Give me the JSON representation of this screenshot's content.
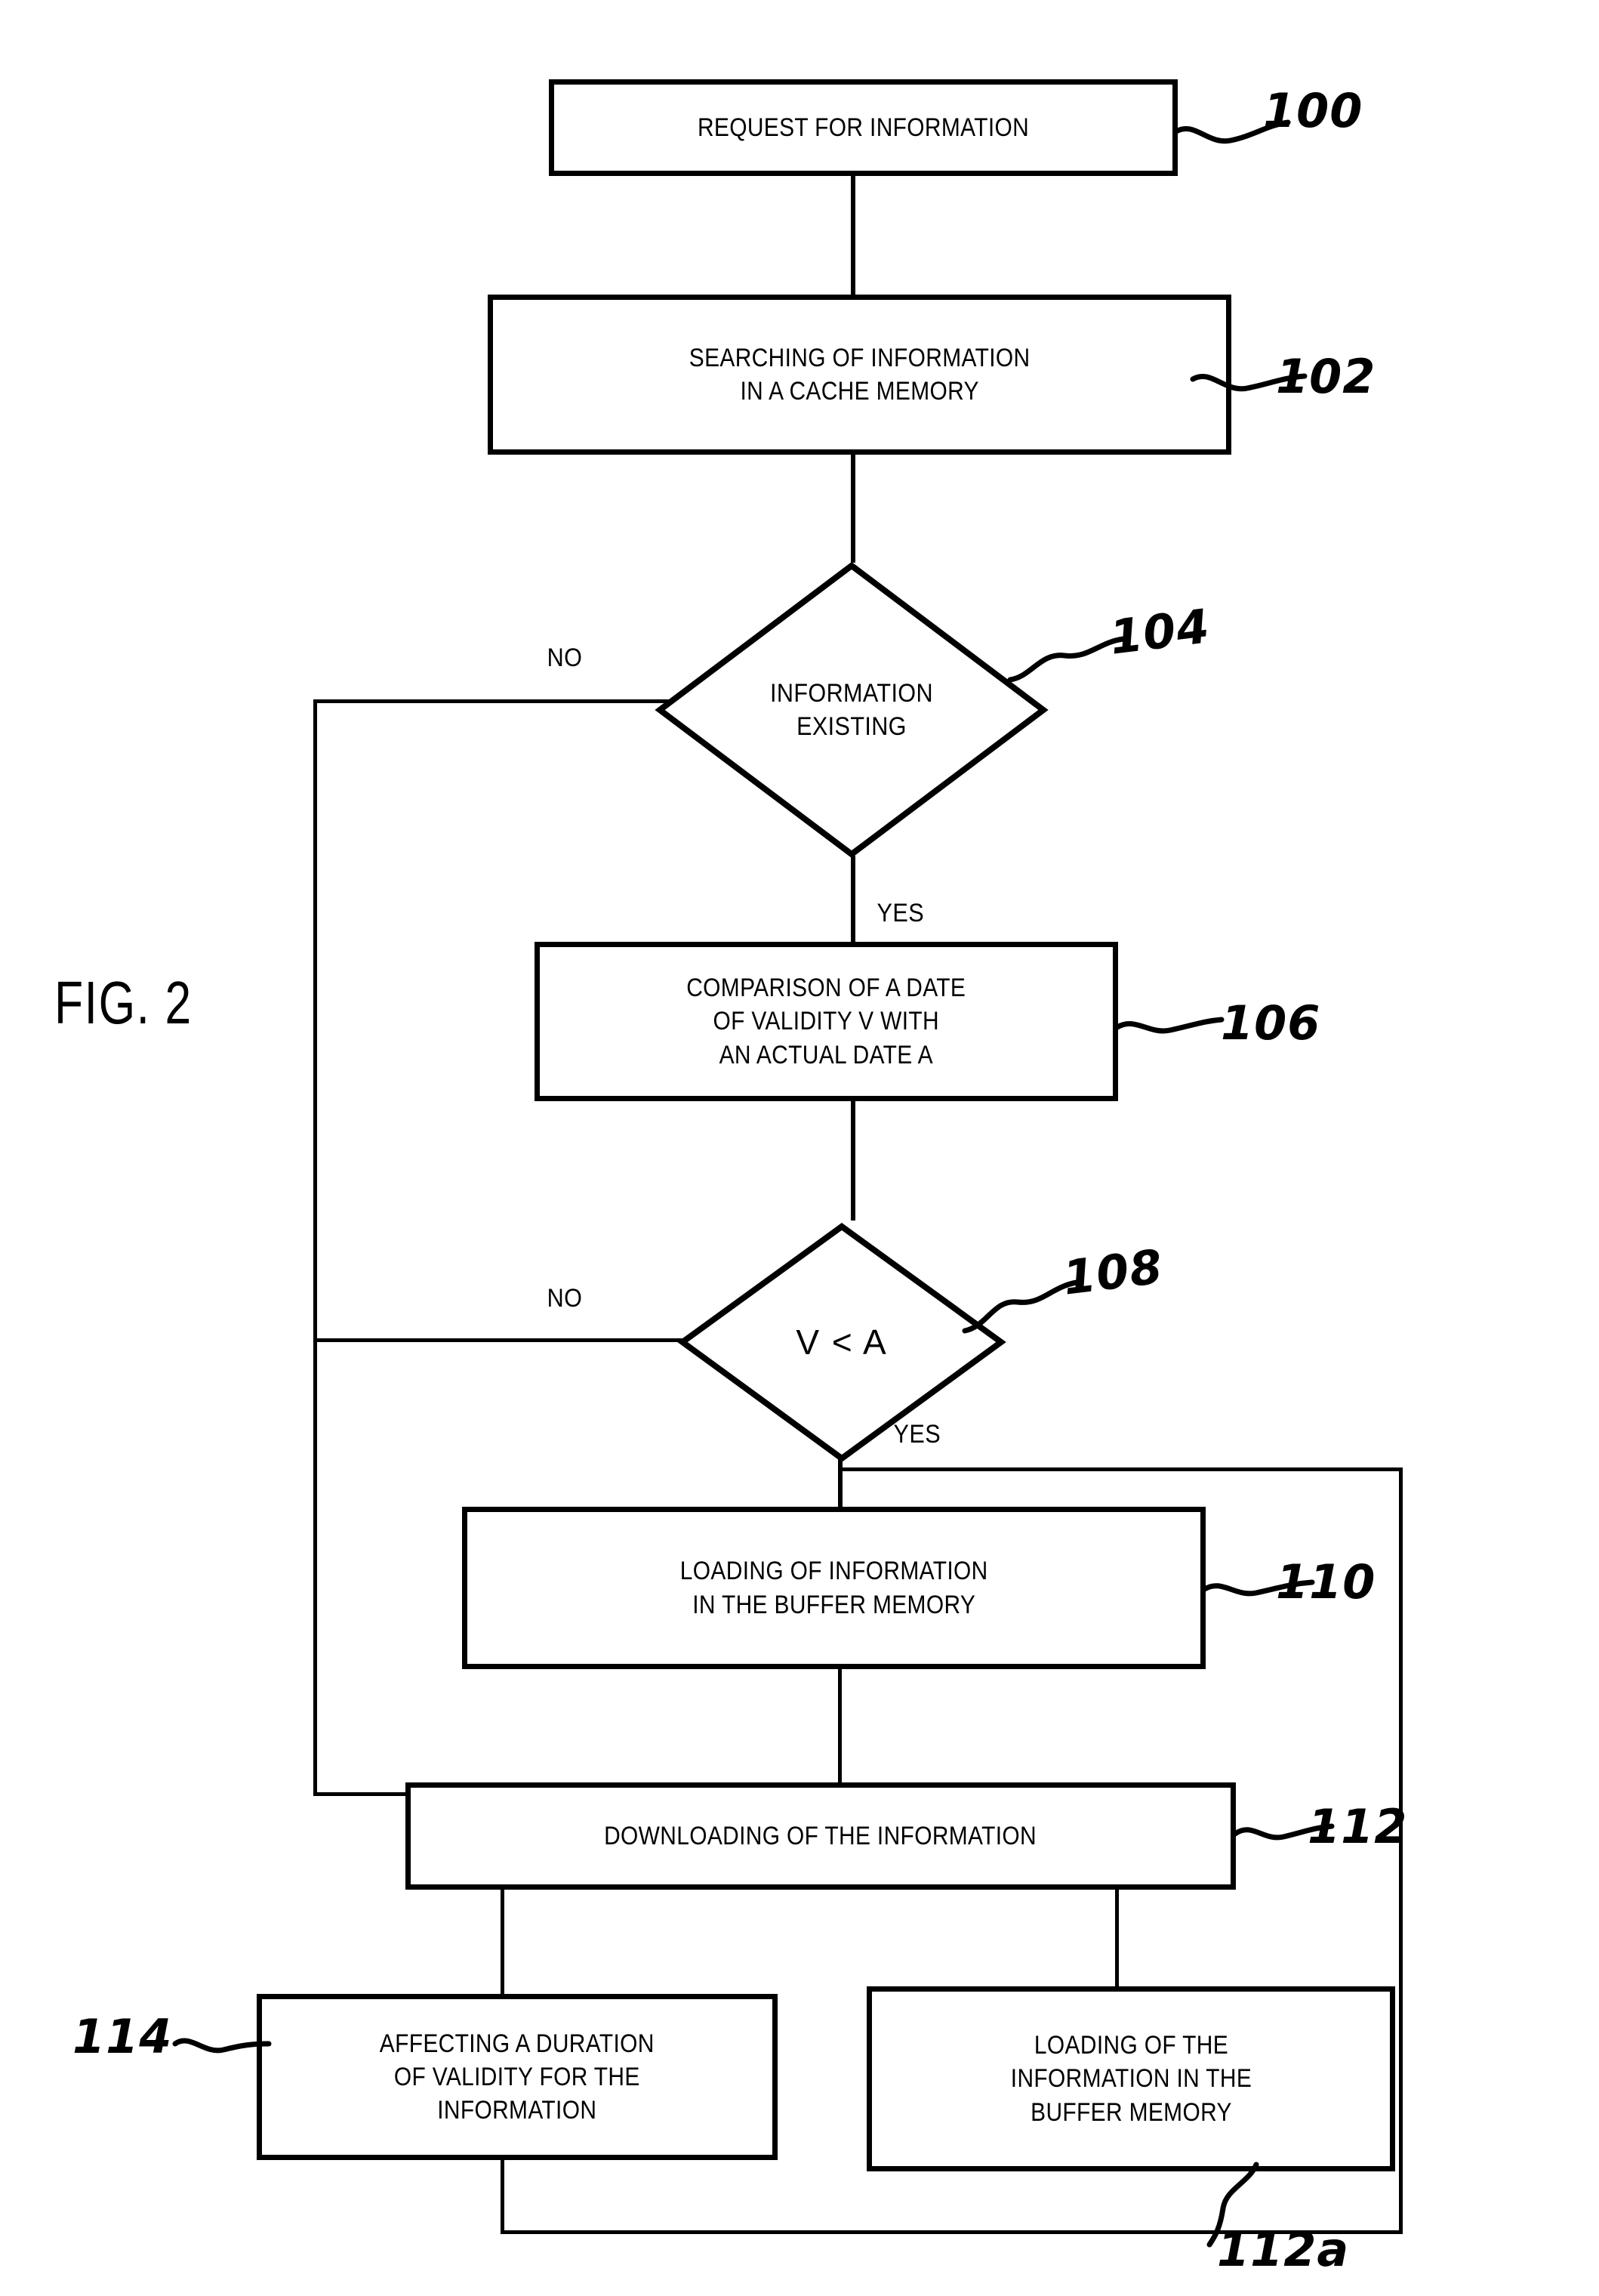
{
  "figure": {
    "caption": "FIG. 2",
    "type": "patent-flowchart"
  },
  "nodes": [
    {
      "ref": "100",
      "shape": "process",
      "text": "REQUEST FOR INFORMATION"
    },
    {
      "ref": "102",
      "shape": "process",
      "text": "SEARCHING OF INFORMATION\nIN A CACHE MEMORY"
    },
    {
      "ref": "104",
      "shape": "decision",
      "text": "INFORMATION\nEXISTING"
    },
    {
      "ref": "106",
      "shape": "process",
      "text": "COMPARISON OF A DATE\nOF VALIDITY V WITH\nAN ACTUAL DATE A"
    },
    {
      "ref": "108",
      "shape": "decision",
      "text": "V < A"
    },
    {
      "ref": "110",
      "shape": "process",
      "text": "LOADING OF INFORMATION\nIN THE BUFFER MEMORY"
    },
    {
      "ref": "112",
      "shape": "process",
      "text": "DOWNLOADING OF THE INFORMATION"
    },
    {
      "ref": "114",
      "shape": "process",
      "text": "AFFECTING A DURATION\nOF VALIDITY FOR THE\nINFORMATION"
    },
    {
      "ref": "112a",
      "shape": "process",
      "text": "LOADING OF THE\nINFORMATION IN THE\nBUFFER MEMORY"
    }
  ],
  "branch_labels": {
    "no_104": "NO",
    "yes_104": "YES",
    "no_108": "NO",
    "yes_108": "YES"
  },
  "refs": {
    "r100": "100",
    "r102": "102",
    "r104": "104",
    "r106": "106",
    "r108": "108",
    "r110": "110",
    "r112": "112",
    "r114": "114",
    "r112a": "112a"
  },
  "colors": {
    "ink": "#000000",
    "paper": "#ffffff"
  }
}
